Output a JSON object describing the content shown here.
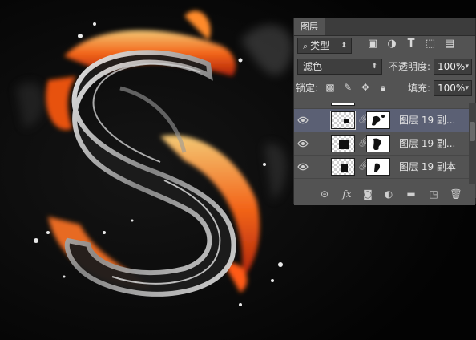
{
  "panel": {
    "tab_title": "图层",
    "filter": {
      "kind_label": "类型",
      "icons": [
        "image-filter-icon",
        "adjustment-filter-icon",
        "type-filter-icon",
        "shape-filter-icon",
        "smart-object-filter-icon"
      ]
    },
    "blend_mode": "滤色",
    "opacity": {
      "label": "不透明度:",
      "value": "100%"
    },
    "lock": {
      "label": "锁定:",
      "icons": [
        "lock-transparent-icon",
        "lock-paint-icon",
        "lock-position-icon",
        "lock-all-icon"
      ]
    },
    "fill": {
      "label": "填充:",
      "value": "100%"
    },
    "layers": [
      {
        "name": "图层 19 副...",
        "visible": true,
        "selected": true
      },
      {
        "name": "图层 19 副...",
        "visible": true,
        "selected": false
      },
      {
        "name": "图层 19 副本",
        "visible": true,
        "selected": false
      }
    ],
    "footer_icons": [
      "link-layers-icon",
      "fx-icon",
      "add-mask-icon",
      "adjustment-layer-icon",
      "new-group-icon",
      "new-layer-icon",
      "delete-layer-icon"
    ],
    "footer_fx_label": "fx"
  },
  "colors": {
    "panel_bg": "#535353",
    "selected_row": "#5b6074",
    "fire": "#ff6a1a",
    "canvas_bg": "#050505"
  }
}
